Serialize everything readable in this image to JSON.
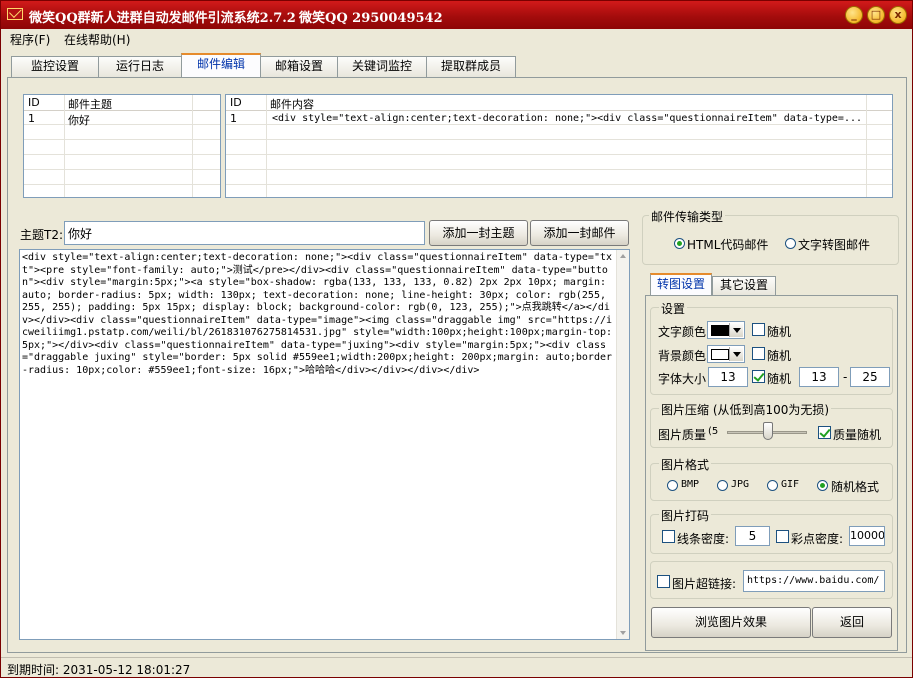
{
  "window": {
    "title": "微笑QQ群新人进群自动发邮件引流系统2.7.2",
    "qq": "微笑QQ 2950049542",
    "btn_min": "_",
    "btn_max": "□",
    "btn_close": "x"
  },
  "menu": {
    "program": "程序(F)",
    "help": "在线帮助(H)"
  },
  "tabs": [
    "监控设置",
    "运行日志",
    "邮件编辑",
    "邮箱设置",
    "关键词监控",
    "提取群成员"
  ],
  "active_tab": "邮件编辑",
  "subject_grid": {
    "headers": {
      "id": "ID",
      "subject": "邮件主题"
    },
    "rows": [
      {
        "id": "1",
        "subject": "你好"
      }
    ]
  },
  "content_grid": {
    "headers": {
      "id": "ID",
      "content": "邮件内容"
    },
    "rows": [
      {
        "id": "1",
        "content": "<div style=\"text-align:center;text-decoration: none;\"><div class=\"questionnaireItem\" data-type=..."
      }
    ]
  },
  "editor": {
    "subject_label": "主题T2:",
    "subject_value": "你好",
    "add_subject_btn": "添加一封主题",
    "add_mail_btn": "添加一封邮件",
    "body": "<div style=\"text-align:center;text-decoration: none;\"><div class=\"questionnaireItem\" data-type=\"txt\"><pre style=\"font-family: auto;\">测试</pre></div><div class=\"questionnaireItem\" data-type=\"button\"><div style=\"margin:5px;\"><a style=\"box-shadow: rgba(133, 133, 133, 0.82) 2px 2px 10px; margin: auto; border-radius: 5px; width: 130px; text-decoration: none; line-height: 30px; color: rgb(255, 255, 255); padding: 5px 15px; display: block; background-color: rgb(0, 123, 255);\">点我跳转</a></div></div><div class=\"questionnaireItem\" data-type=\"image\"><img class=\"draggable img\" src=\"https://icweiliimg1.pstatp.com/weili/bl/261831076275814531.jpg\" style=\"width:100px;height:100px;margin-top:5px;\"></div><div class=\"questionnaireItem\" data-type=\"juxing\"><div style=\"margin:5px;\"><div class=\"draggable juxing\" style=\"border: 5px solid #559ee1;width:200px;height: 200px;margin: auto;border-radius: 10px;color: #559ee1;font-size: 16px;\">哈哈哈</div></div></div></div>"
  },
  "transfer": {
    "title": "邮件传输类型",
    "html_option": "HTML代码邮件",
    "text_option": "文字转图邮件",
    "selected": "html"
  },
  "sub_tabs": [
    "转图设置",
    "其它设置"
  ],
  "settings": {
    "group_title": "设置",
    "text_color_label": "文字颜色",
    "bg_color_label": "背景颜色",
    "random_label": "随机",
    "text_color": "#000000",
    "bg_color": "#ffffff",
    "text_color_random": false,
    "bg_color_random": false,
    "font_size_label": "字体大小",
    "font_size": "13",
    "font_random": true,
    "font_min": "13",
    "font_max": "25",
    "range_sep": "-"
  },
  "compress": {
    "title": "图片压缩 (从低到高100为无损)",
    "quality_label": "图片质量",
    "quality_value_text": "(5",
    "quality_level": 0.5,
    "quality_random_label": "质量随机",
    "quality_random": true
  },
  "format": {
    "title": "图片格式",
    "options": [
      "BMP",
      "JPG",
      "GIF",
      "随机格式"
    ],
    "selected": "随机格式"
  },
  "noise": {
    "title": "图片打码",
    "line_label": "线条密度:",
    "line_value": "5",
    "dot_label": "彩点密度:",
    "dot_value": "10000"
  },
  "link": {
    "label": "图片超链接:",
    "value": "https://www.baidu.com/"
  },
  "preview_btn": "浏览图片效果",
  "back_btn": "返回",
  "status": {
    "expire": "到期时间: 2031-05-12 18:01:27"
  }
}
